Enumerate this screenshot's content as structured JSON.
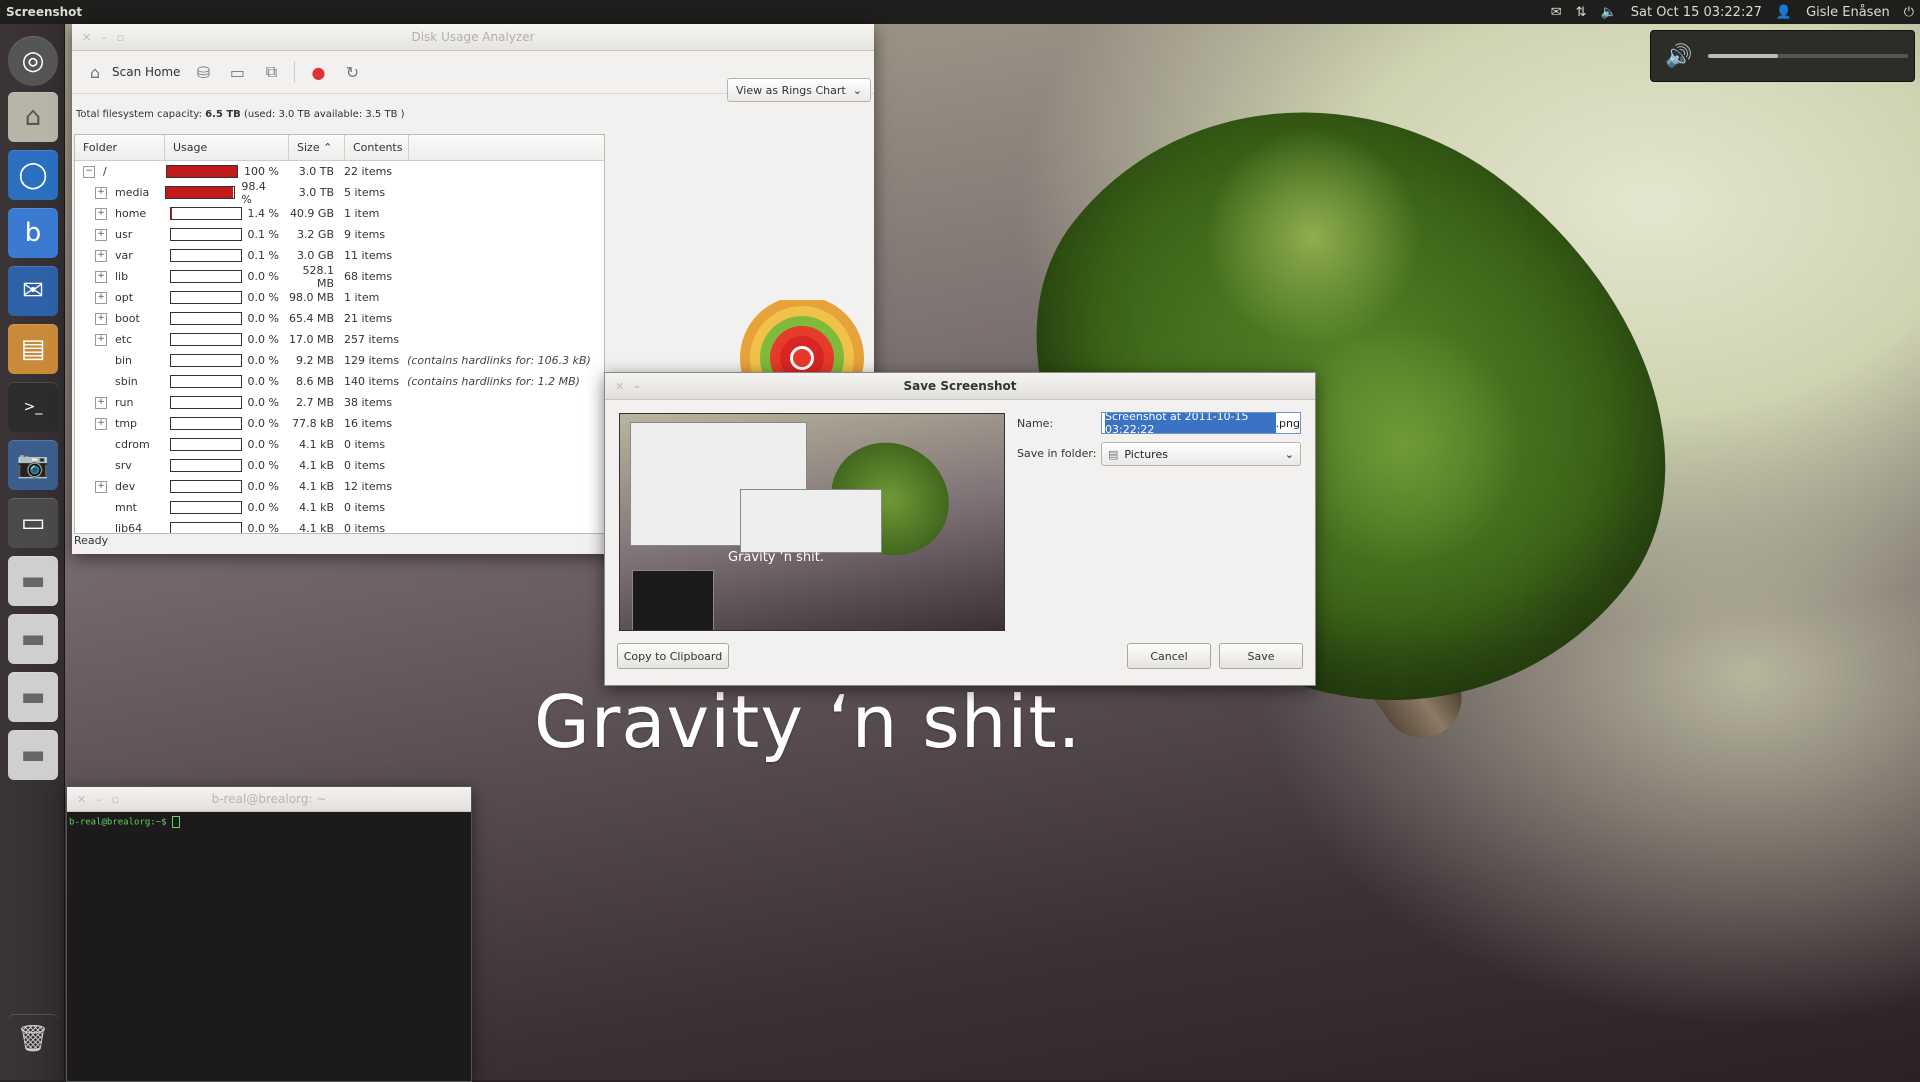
{
  "top_panel": {
    "app_title": "Screenshot",
    "datetime": "Sat Oct 15 03:22:27",
    "user": "Gisle Enåsen",
    "icons": [
      "mail-icon",
      "network-icon",
      "volume-icon",
      "user-icon",
      "session-icon"
    ]
  },
  "volume_popup": {
    "level": 0.35,
    "icon": "speaker-icon"
  },
  "launcher": {
    "items": [
      "dash-icon",
      "home-folder-icon",
      "chromium-icon",
      "blogging-icon",
      "thunderbird-icon",
      "file-manager-icon",
      "terminal-icon",
      "screenshot-icon",
      "window-icon",
      "drive-icon",
      "drive-icon",
      "drive-icon",
      "drive-icon",
      "trash-icon"
    ]
  },
  "wallpaper": {
    "caption": "Gravity ‘n shit."
  },
  "dua": {
    "title": "Disk Usage Analyzer",
    "toolbar": {
      "scan_home": "Scan Home"
    },
    "capacity": {
      "prefix": "Total filesystem capacity:",
      "total": "6.5 TB",
      "detail": "(used: 3.0 TB available: 3.5 TB )"
    },
    "view_select": "View as Rings Chart",
    "columns": [
      "Folder",
      "Usage",
      "Size",
      "Contents"
    ],
    "rows": [
      {
        "name": "/",
        "expander": "−",
        "pct": "100 %",
        "fill": 1.0,
        "size": "3.0 TB",
        "contents": "22 items",
        "note": ""
      },
      {
        "name": "media",
        "expander": "+",
        "pct": "98.4 %",
        "fill": 0.984,
        "size": "3.0 TB",
        "contents": "5 items",
        "note": ""
      },
      {
        "name": "home",
        "expander": "+",
        "pct": "1.4 %",
        "fill": 0.014,
        "size": "40.9 GB",
        "contents": "1 item",
        "note": ""
      },
      {
        "name": "usr",
        "expander": "+",
        "pct": "0.1 %",
        "fill": 0.001,
        "size": "3.2 GB",
        "contents": "9 items",
        "note": ""
      },
      {
        "name": "var",
        "expander": "+",
        "pct": "0.1 %",
        "fill": 0.001,
        "size": "3.0 GB",
        "contents": "11 items",
        "note": ""
      },
      {
        "name": "lib",
        "expander": "+",
        "pct": "0.0 %",
        "fill": 0,
        "size": "528.1 MB",
        "contents": "68 items",
        "note": ""
      },
      {
        "name": "opt",
        "expander": "+",
        "pct": "0.0 %",
        "fill": 0,
        "size": "98.0 MB",
        "contents": "1 item",
        "note": ""
      },
      {
        "name": "boot",
        "expander": "+",
        "pct": "0.0 %",
        "fill": 0,
        "size": "65.4 MB",
        "contents": "21 items",
        "note": ""
      },
      {
        "name": "etc",
        "expander": "+",
        "pct": "0.0 %",
        "fill": 0,
        "size": "17.0 MB",
        "contents": "257 items",
        "note": ""
      },
      {
        "name": "bin",
        "expander": "",
        "pct": "0.0 %",
        "fill": 0,
        "size": "9.2 MB",
        "contents": "129 items",
        "note": "(contains hardlinks for: 106.3 kB)"
      },
      {
        "name": "sbin",
        "expander": "",
        "pct": "0.0 %",
        "fill": 0,
        "size": "8.6 MB",
        "contents": "140 items",
        "note": "(contains hardlinks for: 1.2 MB)"
      },
      {
        "name": "run",
        "expander": "+",
        "pct": "0.0 %",
        "fill": 0,
        "size": "2.7 MB",
        "contents": "38 items",
        "note": ""
      },
      {
        "name": "tmp",
        "expander": "+",
        "pct": "0.0 %",
        "fill": 0,
        "size": "77.8 kB",
        "contents": "16 items",
        "note": ""
      },
      {
        "name": "cdrom",
        "expander": "",
        "pct": "0.0 %",
        "fill": 0,
        "size": "4.1 kB",
        "contents": "0 items",
        "note": ""
      },
      {
        "name": "srv",
        "expander": "",
        "pct": "0.0 %",
        "fill": 0,
        "size": "4.1 kB",
        "contents": "0 items",
        "note": ""
      },
      {
        "name": "dev",
        "expander": "+",
        "pct": "0.0 %",
        "fill": 0,
        "size": "4.1 kB",
        "contents": "12 items",
        "note": ""
      },
      {
        "name": "mnt",
        "expander": "",
        "pct": "0.0 %",
        "fill": 0,
        "size": "4.1 kB",
        "contents": "0 items",
        "note": ""
      },
      {
        "name": "lib64",
        "expander": "",
        "pct": "0.0 %",
        "fill": 0,
        "size": "4.1 kB",
        "contents": "0 items",
        "note": ""
      }
    ],
    "status": "Ready",
    "bar_color": "#c01a1a"
  },
  "save_dialog": {
    "title": "Save Screenshot",
    "name_label": "Name:",
    "name_selected": "Screenshot at 2011-10-15 03:22:22",
    "name_ext": ".png",
    "folder_label": "Save in folder:",
    "folder_value": "Pictures",
    "preview_caption": "Gravity ‘n shit.",
    "copy_button": "Copy to Clipboard",
    "cancel_button": "Cancel",
    "save_button": "Save"
  },
  "terminal": {
    "title": "b-real@brealorg: ~",
    "prompt": "b-real@brealorg:~$"
  }
}
